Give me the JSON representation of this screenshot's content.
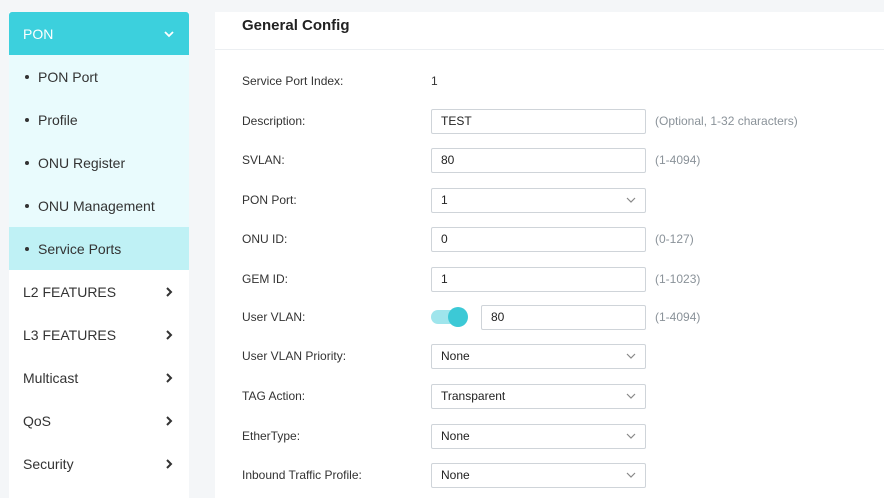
{
  "sidebar": {
    "section": "PON",
    "sub_items": [
      "PON Port",
      "Profile",
      "ONU Register",
      "ONU Management",
      "Service Ports"
    ],
    "active": "Service Ports",
    "groups": [
      "L2 FEATURES",
      "L3 FEATURES",
      "Multicast",
      "QoS",
      "Security"
    ]
  },
  "panel": {
    "title": "General Config",
    "service_port_index": {
      "label": "Service Port Index:",
      "value": "1"
    },
    "description": {
      "label": "Description:",
      "value": "TEST",
      "hint": "(Optional, 1-32 characters)"
    },
    "svlan": {
      "label": "SVLAN:",
      "value": "80",
      "hint": "(1-4094)"
    },
    "pon_port": {
      "label": "PON Port:",
      "value": "1"
    },
    "onu_id": {
      "label": "ONU ID:",
      "value": "0",
      "hint": "(0-127)"
    },
    "gem_id": {
      "label": "GEM ID:",
      "value": "1",
      "hint": "(1-1023)"
    },
    "user_vlan": {
      "label": "User VLAN:",
      "value": "80",
      "hint": "(1-4094)",
      "toggle_on": true
    },
    "user_vlan_priority": {
      "label": "User VLAN Priority:",
      "value": "None"
    },
    "tag_action": {
      "label": "TAG Action:",
      "value": "Transparent"
    },
    "ethertype": {
      "label": "EtherType:",
      "value": "None"
    },
    "inbound_traffic_profile": {
      "label": "Inbound Traffic Profile:",
      "value": "None"
    }
  },
  "colors": {
    "accent": "#3cd0dd",
    "active_bg": "#bff1f5",
    "submenu_bg": "#e9fbfd"
  }
}
